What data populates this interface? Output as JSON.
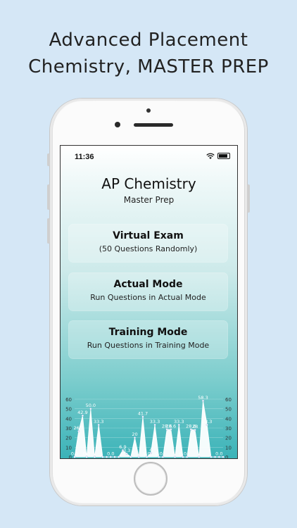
{
  "headline": {
    "line1": "Advanced Placement",
    "line2": "Chemistry, MASTER PREP"
  },
  "status_bar": {
    "time": "11:36",
    "wifi_icon": "wifi-icon",
    "battery_icon": "battery-icon"
  },
  "app": {
    "title": "AP Chemistry",
    "subtitle": "Master Prep"
  },
  "modes": [
    {
      "title": "Virtual Exam",
      "subtitle": "(50 Questions Randomly)"
    },
    {
      "title": "Actual Mode",
      "subtitle": "Run Questions in Actual Mode"
    },
    {
      "title": "Training Mode",
      "subtitle": "Run Questions in Training Mode"
    }
  ],
  "chart_data": {
    "type": "area",
    "title": "",
    "ylim": [
      0,
      60
    ],
    "yticks": [
      0,
      10,
      20,
      30,
      40,
      50,
      60
    ],
    "color": "#ffffff",
    "values": [
      0,
      26.7,
      42.9,
      0,
      50.0,
      0,
      33.3,
      0,
      0,
      0.0,
      0,
      0,
      6.9,
      3.3,
      0,
      20.0,
      0,
      41.7,
      0,
      4,
      33.3,
      0,
      0,
      28.6,
      28.6,
      0,
      33.3,
      0,
      0,
      28.6,
      28.0,
      0,
      58.3,
      33.3,
      0,
      0,
      0.0,
      0
    ]
  }
}
